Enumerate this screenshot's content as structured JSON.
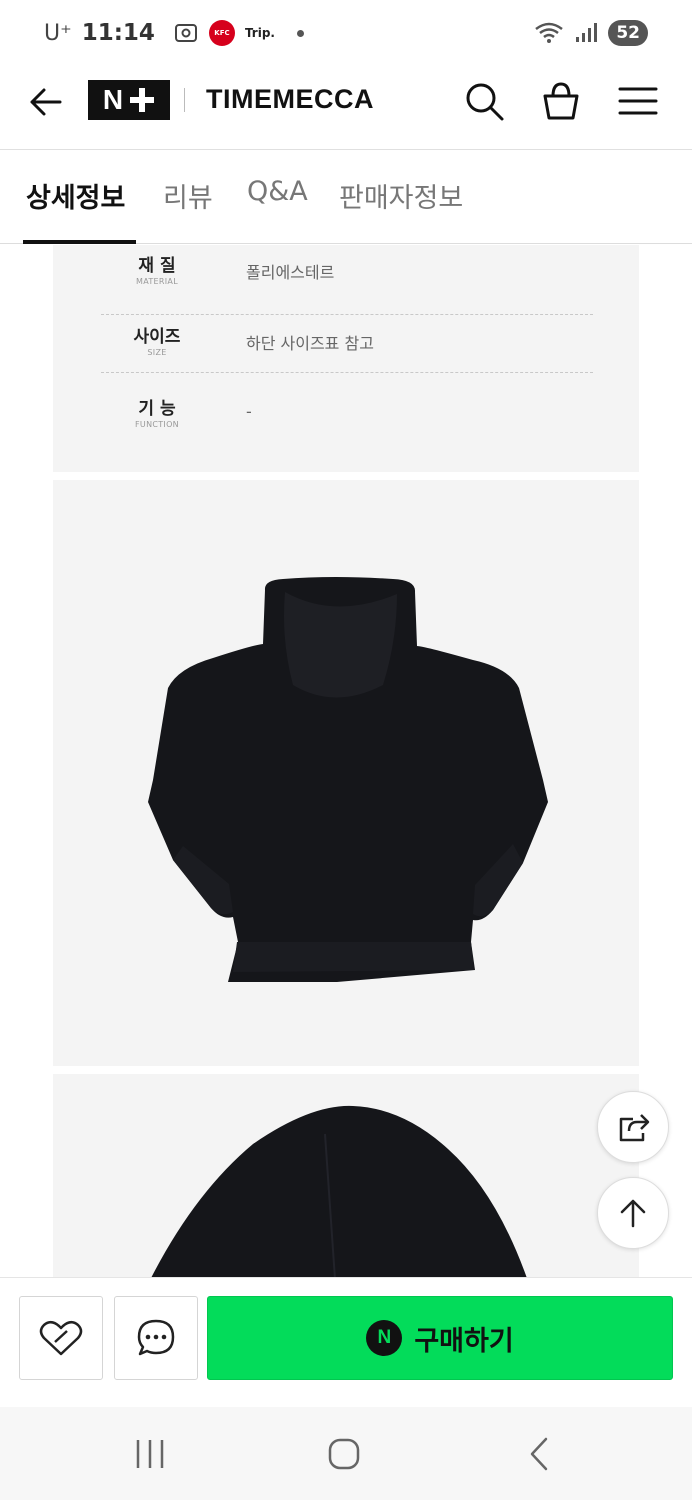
{
  "status_bar": {
    "carrier": "U⁺",
    "time": "11:14",
    "kfc_badge": "KFC",
    "trip_label": "Trip.",
    "battery": "52"
  },
  "header": {
    "logo_text": "N",
    "brand_name": "TIMEMECCA",
    "icons": [
      "back-arrow-icon",
      "search-icon",
      "shopping-bag-icon",
      "menu-icon"
    ]
  },
  "tabs": [
    {
      "label": "상세정보",
      "active": true
    },
    {
      "label": "리뷰",
      "active": false
    },
    {
      "label": "Q&A",
      "active": false
    },
    {
      "label": "판매자정보",
      "active": false
    }
  ],
  "specs": [
    {
      "label": "재 질",
      "sub": "MATERIAL",
      "value": "폴리에스테르"
    },
    {
      "label": "사이즈",
      "sub": "SIZE",
      "value": "하단 사이즈표 참고"
    },
    {
      "label": "기 능",
      "sub": "FUNCTION",
      "value": "-"
    }
  ],
  "images": [
    {
      "subject": "black hoodie back view"
    },
    {
      "subject": "black hoodie hood close-up"
    }
  ],
  "floating": {
    "icons": [
      "share-icon",
      "scroll-top-icon"
    ]
  },
  "action_bar": {
    "buy_badge": "N",
    "buy_label": "구매하기",
    "icons": [
      "heart-icon",
      "chat-icon"
    ],
    "accent_color": "#03dc5a"
  },
  "nav": {
    "icons": [
      "recents-icon",
      "home-icon",
      "back-icon"
    ]
  }
}
